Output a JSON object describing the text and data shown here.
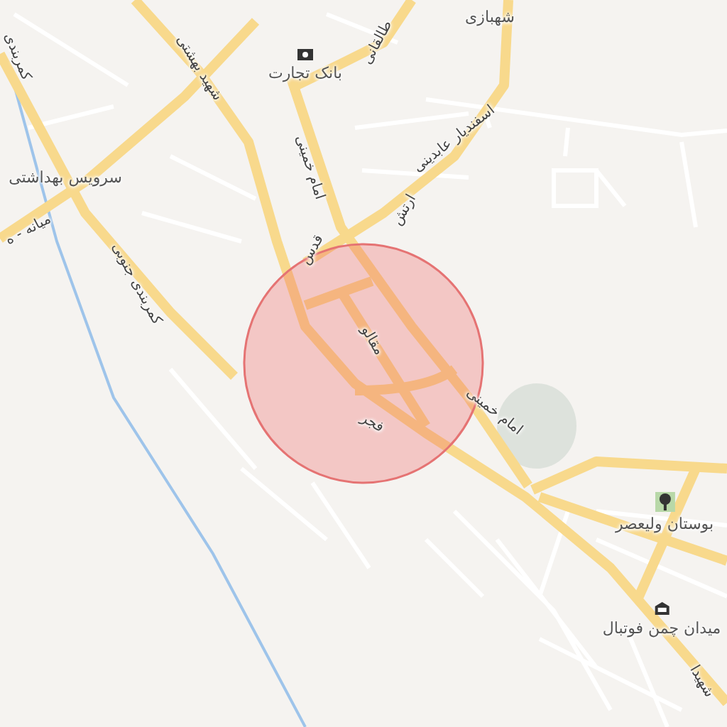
{
  "map": {
    "labels": [
      {
        "text": "شهبازی",
        "kind": "place"
      },
      {
        "text": "بانک تجارت",
        "kind": "poi"
      },
      {
        "text": "طالقانی",
        "kind": "street"
      },
      {
        "text": "شهید بهشتی",
        "kind": "street"
      },
      {
        "text": "کمربندی",
        "kind": "street"
      },
      {
        "text": "سرویس بهداشتی",
        "kind": "place"
      },
      {
        "text": "میانه - ه",
        "kind": "street"
      },
      {
        "text": "امام خمینی",
        "kind": "street"
      },
      {
        "text": "اسفندیار عابدینی",
        "kind": "street"
      },
      {
        "text": "ارتش",
        "kind": "street"
      },
      {
        "text": "کمربندی جنوبی",
        "kind": "street"
      },
      {
        "text": "قدس",
        "kind": "street"
      },
      {
        "text": "مقالو",
        "kind": "street"
      },
      {
        "text": "فجر",
        "kind": "street"
      },
      {
        "text": "امام خمینی",
        "kind": "street"
      },
      {
        "text": "بوستان ولیعصر",
        "kind": "poi"
      },
      {
        "text": "میدان چمن فوتبال",
        "kind": "poi"
      },
      {
        "text": "شهیدا",
        "kind": "street"
      }
    ]
  }
}
